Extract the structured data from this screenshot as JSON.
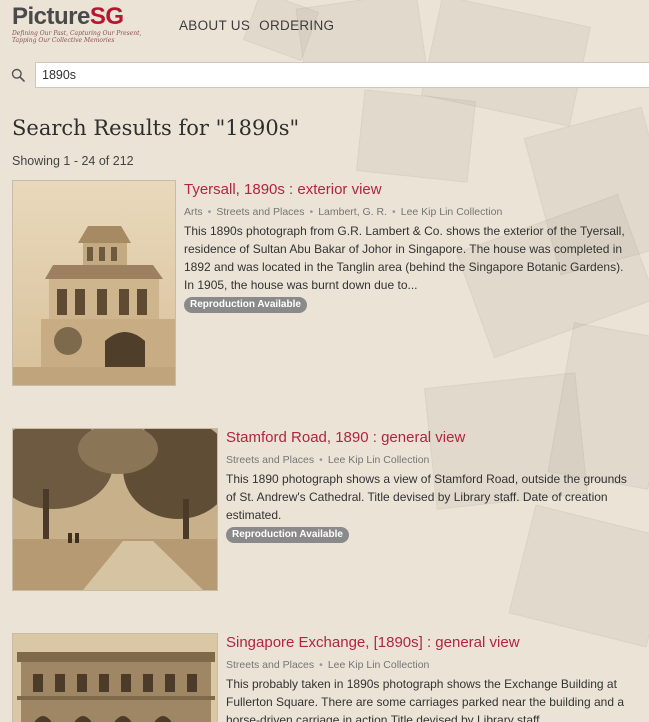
{
  "logo": {
    "part1": "Picture",
    "part2": "SG",
    "tagline": "Defining Our Past, Capturing Our Present, Tapping Our Collective Memories"
  },
  "nav": {
    "about": "ABOUT US",
    "ordering": "ORDERING"
  },
  "search": {
    "value": "1890s",
    "placeholder": ""
  },
  "results_title": "Search Results for \"1890s\"",
  "showing": "Showing 1 - 24 of 212",
  "results": [
    {
      "title": "Tyersall, 1890s : exterior view",
      "tags": [
        "Arts",
        "Streets and Places",
        "Lambert, G. R.",
        "Lee Kip Lin Collection"
      ],
      "description": "This 1890s photograph from G.R. Lambert & Co. shows the exterior of the Tyersall, residence of Sultan Abu Bakar of Johor in Singapore. The house was completed in 1892 and was located in the Tanglin area (behind the Singapore Botanic Gardens). In 1905, the house was burnt down due to...",
      "badge": "Reproduction Available"
    },
    {
      "title": "Stamford Road, 1890 : general view",
      "tags": [
        "Streets and Places",
        "Lee Kip Lin Collection"
      ],
      "description": "This 1890 photograph shows a view of Stamford Road, outside the grounds of St. Andrew's Cathedral. Title devised by Library staff. Date of creation estimated.",
      "badge": "Reproduction Available"
    },
    {
      "title": "Singapore Exchange, [1890s] : general view",
      "tags": [
        "Streets and Places",
        "Lee Kip Lin Collection"
      ],
      "description": "This probably taken in 1890s photograph shows the Exchange Building at Fullerton Square. There are some carriages parked near the building and a horse-driven carriage in action.Title devised by Library staff.",
      "badge": ""
    }
  ],
  "colors": {
    "brand_red": "#b5172e",
    "title_red": "#b0263f",
    "badge_gray": "#8a8a8a",
    "background": "#ebe3d6"
  }
}
